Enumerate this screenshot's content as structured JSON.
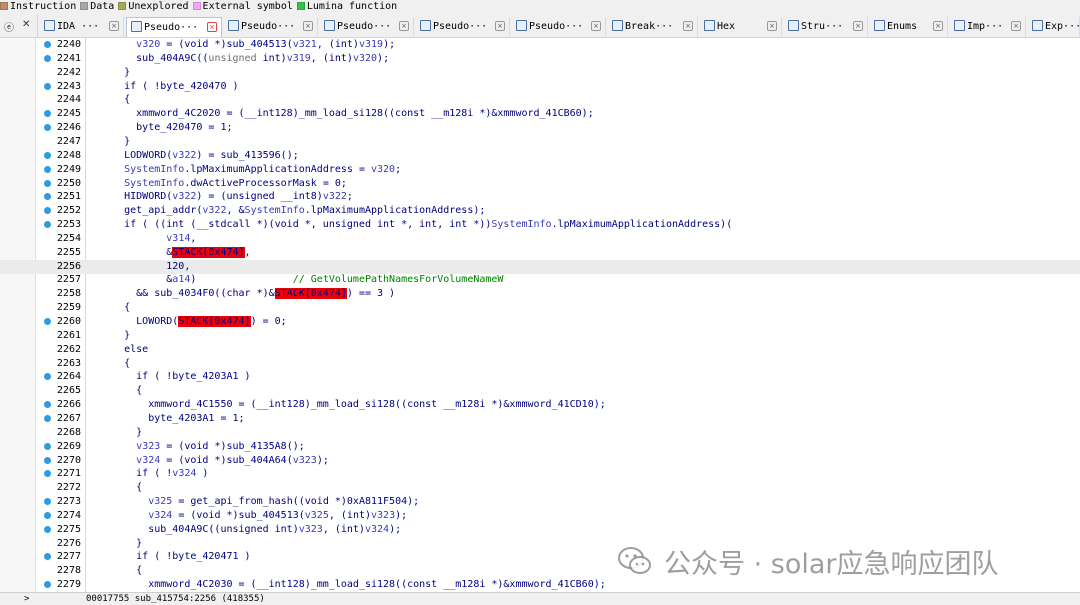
{
  "legend": [
    {
      "label": "Instruction",
      "color": "#c08b6b"
    },
    {
      "label": "Data",
      "color": "#a8a8a8"
    },
    {
      "label": "Unexplored",
      "color": "#a7a65a"
    },
    {
      "label": "External symbol",
      "color": "#f4a6f2"
    },
    {
      "label": "Lumina function",
      "color": "#34c34a"
    }
  ],
  "toolbar_left": {
    "icon1": "ⓔ",
    "icon2": "✕"
  },
  "tabs": [
    {
      "label": "IDA ···",
      "icon": "ida-view-icon"
    },
    {
      "label": "Pseudo···",
      "icon": "pseudocode-icon",
      "active": true
    },
    {
      "label": "Pseudo···",
      "icon": "pseudocode-icon"
    },
    {
      "label": "Pseudo···",
      "icon": "pseudocode-icon"
    },
    {
      "label": "Pseudo···",
      "icon": "pseudocode-icon"
    },
    {
      "label": "Pseudo···",
      "icon": "pseudocode-icon"
    },
    {
      "label": "Break···",
      "icon": "breakpoints-icon"
    },
    {
      "label": "Hex",
      "icon": "hex-view-icon"
    },
    {
      "label": "Stru···",
      "icon": "structures-icon"
    },
    {
      "label": "Enums",
      "icon": "enums-icon"
    },
    {
      "label": "Imp···",
      "icon": "imports-icon"
    },
    {
      "label": "Exp···",
      "icon": "exports-icon"
    }
  ],
  "code_lines": [
    {
      "n": "2240",
      "bp": true,
      "t": "        <v>v320</v> = (void *)sub_404513(<v>v321</v>, (int)<v>v319</v>);"
    },
    {
      "n": "2241",
      "bp": true,
      "t": "        sub_404A9C((<g>unsigned</g> int)<v>v319</v>, (int)<v>v320</v>);"
    },
    {
      "n": "2242",
      "bp": false,
      "t": "      }"
    },
    {
      "n": "2243",
      "bp": true,
      "t": "      if ( !byte_420470 )"
    },
    {
      "n": "2244",
      "bp": false,
      "t": "      {"
    },
    {
      "n": "2245",
      "bp": true,
      "t": "        xmmword_4C2020 = (__int128)_mm_load_si128((const __m128i *)&amp;xmmword_41CB60);"
    },
    {
      "n": "2246",
      "bp": true,
      "t": "        byte_420470 = 1;"
    },
    {
      "n": "2247",
      "bp": false,
      "t": "      }"
    },
    {
      "n": "2248",
      "bp": true,
      "t": "      LODWORD(<v>v322</v>) = sub_413596();"
    },
    {
      "n": "2249",
      "bp": true,
      "t": "      <v>SystemInfo</v>.lpMaximumApplicationAddress = <v>v320</v>;"
    },
    {
      "n": "2250",
      "bp": true,
      "t": "      <v>SystemInfo</v>.dwActiveProcessorMask = 0;"
    },
    {
      "n": "2251",
      "bp": true,
      "t": "      HIDWORD(<v>v322</v>) = (unsigned __int8)<v>v322</v>;"
    },
    {
      "n": "2252",
      "bp": true,
      "t": "      get_api_addr(<v>v322</v>, &amp;<v>SystemInfo</v>.lpMaximumApplicationAddress);"
    },
    {
      "n": "2253",
      "bp": true,
      "t": "      if ( ((int (__stdcall *)(void *, unsigned int *, int, int *))<v>SystemInfo</v>.lpMaximumApplicationAddress)("
    },
    {
      "n": "2254",
      "bp": false,
      "t": "             <v>v314</v>,"
    },
    {
      "n": "2255",
      "bp": false,
      "t": "             &amp;<hl>STACK[0x474]</hl>,"
    },
    {
      "n": "2256",
      "bp": false,
      "current": true,
      "t": "             120,"
    },
    {
      "n": "2257",
      "bp": false,
      "t": "             &amp;<v>a14</v>)                <cm>// GetVolumePathNamesForVolumeNameW</cm>"
    },
    {
      "n": "2258",
      "bp": false,
      "t": "        &amp;&amp; sub_4034F0((char *)&amp;<hl>STACK[0x474]</hl>) == 3 )"
    },
    {
      "n": "2259",
      "bp": false,
      "t": "      {"
    },
    {
      "n": "2260",
      "bp": true,
      "t": "        LOWORD(<hl>STACK[0x474]</hl>) = 0;"
    },
    {
      "n": "2261",
      "bp": false,
      "t": "      }"
    },
    {
      "n": "2262",
      "bp": false,
      "t": "      else"
    },
    {
      "n": "2263",
      "bp": false,
      "t": "      {"
    },
    {
      "n": "2264",
      "bp": true,
      "t": "        if ( !byte_4203A1 )"
    },
    {
      "n": "2265",
      "bp": false,
      "t": "        {"
    },
    {
      "n": "2266",
      "bp": true,
      "t": "          xmmword_4C1550 = (__int128)_mm_load_si128((const __m128i *)&amp;xmmword_41CD10);"
    },
    {
      "n": "2267",
      "bp": true,
      "t": "          byte_4203A1 = 1;"
    },
    {
      "n": "2268",
      "bp": false,
      "t": "        }"
    },
    {
      "n": "2269",
      "bp": true,
      "t": "        <v>v323</v> = (void *)sub_4135A8();"
    },
    {
      "n": "2270",
      "bp": true,
      "t": "        <v>v324</v> = (void *)sub_404A64(<v>v323</v>);"
    },
    {
      "n": "2271",
      "bp": true,
      "t": "        if ( !<v>v324</v> )"
    },
    {
      "n": "2272",
      "bp": false,
      "t": "        {"
    },
    {
      "n": "2273",
      "bp": true,
      "t": "          <v>v325</v> = get_api_from_hash((void *)0xA811F504);"
    },
    {
      "n": "2274",
      "bp": true,
      "t": "          <v>v324</v> = (void *)sub_404513(<v>v325</v>, (int)<v>v323</v>);"
    },
    {
      "n": "2275",
      "bp": true,
      "t": "          sub_404A9C((unsigned int)<v>v323</v>, (int)<v>v324</v>);"
    },
    {
      "n": "2276",
      "bp": false,
      "t": "        }"
    },
    {
      "n": "2277",
      "bp": true,
      "t": "        if ( !byte_420471 )"
    },
    {
      "n": "2278",
      "bp": false,
      "t": "        {"
    },
    {
      "n": "2279",
      "bp": true,
      "t": "          xmmword_4C2030 = (__int128)_mm_load_si128((const __m128i *)&amp;xmmword_41CB60);"
    }
  ],
  "status": {
    "text": "00017755 sub_415754:2256 (418355)",
    "expand": ">"
  },
  "watermark": {
    "text": "公众号 · solar应急响应团队"
  },
  "colors": {
    "breakpoint": "#2d9be0",
    "highlight": "#e8000b",
    "comment": "#008000",
    "code": "#000080"
  }
}
